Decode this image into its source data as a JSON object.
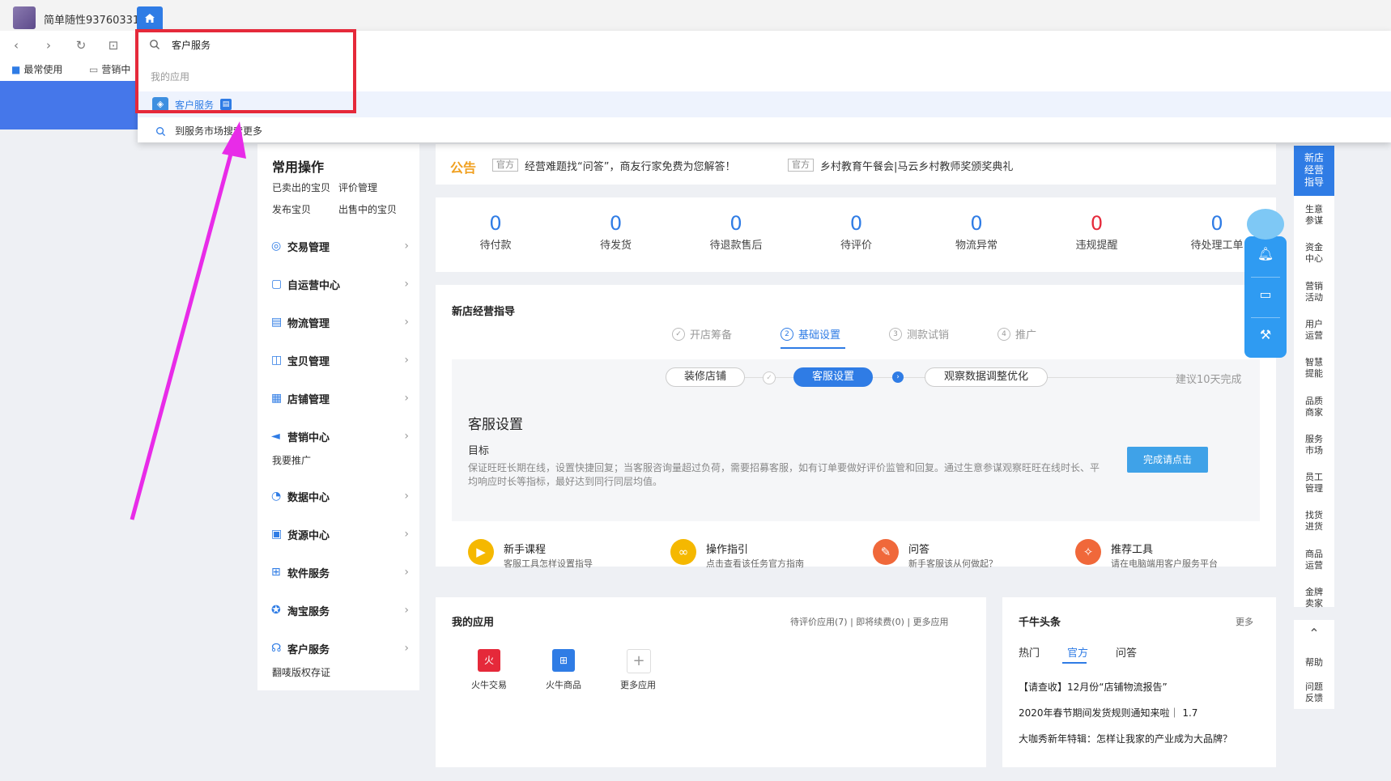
{
  "topbar": {
    "username": "简单随性93760331"
  },
  "bookmarks": [
    {
      "label": "最常使用"
    },
    {
      "label": "营销中"
    }
  ],
  "search": {
    "query": "客户服务",
    "section_label": "我的应用",
    "result_label": "客户服务",
    "more_label": "到服务市场搜索更多"
  },
  "sidebar": {
    "title": "常用操作",
    "quick_links": [
      "已卖出的宝贝",
      "评价管理",
      "发布宝贝",
      "出售中的宝贝"
    ],
    "menu": [
      {
        "label": "交易管理"
      },
      {
        "label": "自运营中心"
      },
      {
        "label": "物流管理"
      },
      {
        "label": "宝贝管理"
      },
      {
        "label": "店铺管理"
      },
      {
        "label": "营销中心",
        "sub": "我要推广"
      },
      {
        "label": "数据中心"
      },
      {
        "label": "货源中心"
      },
      {
        "label": "软件服务"
      },
      {
        "label": "淘宝服务"
      },
      {
        "label": "客户服务",
        "sub": "翻唛版权存证"
      }
    ]
  },
  "notice": {
    "title": "公告",
    "items": [
      {
        "tag": "官方",
        "text": "经营难题找“问答”，商友行家免费为您解答！"
      },
      {
        "tag": "官方",
        "text": "乡村教育午餐会|马云乡村教师奖颁奖典礼"
      }
    ]
  },
  "stats": [
    {
      "value": "0",
      "label": "待付款",
      "color": "#2f7ce5"
    },
    {
      "value": "0",
      "label": "待发货",
      "color": "#2f7ce5"
    },
    {
      "value": "0",
      "label": "待退款售后",
      "color": "#2f7ce5"
    },
    {
      "value": "0",
      "label": "待评价",
      "color": "#2f7ce5"
    },
    {
      "value": "0",
      "label": "物流异常",
      "color": "#2f7ce5"
    },
    {
      "value": "0",
      "label": "违规提醒",
      "color": "#e5293a"
    },
    {
      "value": "0",
      "label": "待处理工单",
      "color": "#2f7ce5"
    }
  ],
  "guide": {
    "title": "新店经营指导",
    "steps": [
      {
        "label": "开店筹备",
        "mark": "✓"
      },
      {
        "label": "基础设置",
        "mark": "2"
      },
      {
        "label": "测款试销",
        "mark": "3"
      },
      {
        "label": "推广",
        "mark": "4"
      }
    ],
    "substeps": [
      "装修店铺",
      "客服设置",
      "观察数据调整优化"
    ],
    "suggest": "建议10天完成",
    "card_title": "客服设置",
    "goal_label": "目标",
    "description": "保证旺旺长期在线，设置快捷回复；当客服咨询量超过负荷，需要招募客服，如有订单要做好评价监管和回复。通过生意参谋观察旺旺在线时长、平均响应时长等指标，最好达到同行同层均值。",
    "button_label": "完成请点击",
    "tools": [
      {
        "title": "新手课程",
        "desc": "客服工具怎样设置指导",
        "color": "#f5b800"
      },
      {
        "title": "操作指引",
        "desc": "点击查看该任务官方指南",
        "color": "#f5b800"
      },
      {
        "title": "问答",
        "desc": "新手客服该从何做起？",
        "color": "#f0683a"
      },
      {
        "title": "推荐工具",
        "desc": "请在电脑端用客户服务平台",
        "color": "#f0683a"
      }
    ]
  },
  "apps": {
    "title": "我的应用",
    "links": "待评价应用(7) | 即将续费(0) | 更多应用",
    "items": [
      {
        "label": "火牛交易",
        "color": "#e5293a"
      },
      {
        "label": "火牛商品",
        "color": "#2f7ce5"
      },
      {
        "label": "更多应用",
        "color": "#ffffff"
      }
    ]
  },
  "news": {
    "title": "千牛头条",
    "more": "更多",
    "tabs": [
      "热门",
      "官方",
      "问答"
    ],
    "items": [
      "【请查收】12月份“店铺物流报告”",
      "2020年春节期间发货规则通知来啦｜ 1.7",
      "大咖秀新年特辑：怎样让我家的产业成为大品牌？"
    ]
  },
  "rightbar": {
    "top": "新店经营指导",
    "items": [
      "生意参谋",
      "资金中心",
      "营销活动",
      "用户运营",
      "智慧提能",
      "品质商家",
      "服务市场",
      "员工管理",
      "找货进货",
      "商品运营",
      "金牌卖家"
    ],
    "help": "帮助",
    "feedback": "问题反馈"
  },
  "colors": {
    "accent": "#2f7ce5",
    "frame": "#e5293a",
    "arrow": "#e82be8"
  }
}
